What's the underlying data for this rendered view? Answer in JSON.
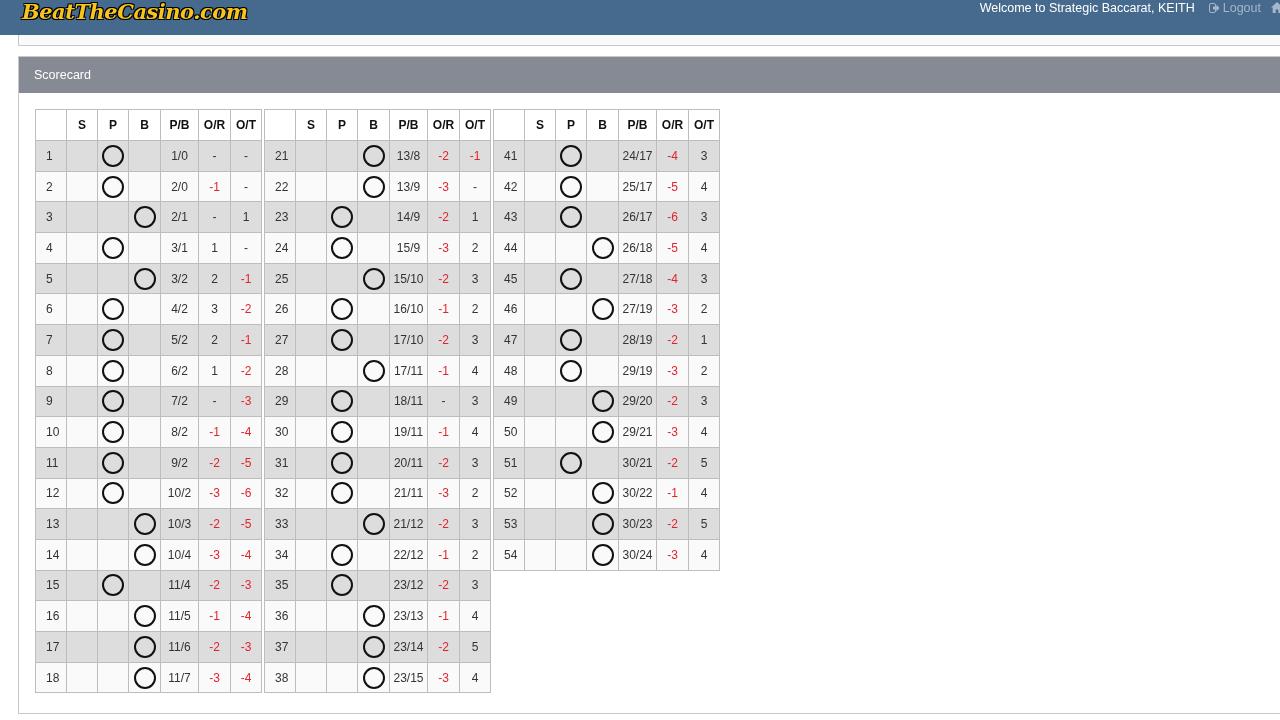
{
  "header": {
    "logo": "BeatTheCasino.com",
    "welcome": "Welcome to Strategic Baccarat, KEITH",
    "logout": "Logout"
  },
  "panel": {
    "title": "Scorecard"
  },
  "tables": [
    {
      "columns": [
        "",
        "S",
        "P",
        "B",
        "P/B",
        "O/R",
        "O/T"
      ],
      "rows": [
        {
          "number": "1",
          "player": true,
          "banker": false,
          "pb": "1/0",
          "or": "-",
          "ot": "-"
        },
        {
          "number": "2",
          "player": true,
          "banker": false,
          "pb": "2/0",
          "or": "-1",
          "ot": "-"
        },
        {
          "number": "3",
          "player": false,
          "banker": true,
          "pb": "2/1",
          "or": "-",
          "ot": "1"
        },
        {
          "number": "4",
          "player": true,
          "banker": false,
          "pb": "3/1",
          "or": "1",
          "ot": "-"
        },
        {
          "number": "5",
          "player": false,
          "banker": true,
          "pb": "3/2",
          "or": "2",
          "ot": "-1"
        },
        {
          "number": "6",
          "player": true,
          "banker": false,
          "pb": "4/2",
          "or": "3",
          "ot": "-2"
        },
        {
          "number": "7",
          "player": true,
          "banker": false,
          "pb": "5/2",
          "or": "2",
          "ot": "-1"
        },
        {
          "number": "8",
          "player": true,
          "banker": false,
          "pb": "6/2",
          "or": "1",
          "ot": "-2"
        },
        {
          "number": "9",
          "player": true,
          "banker": false,
          "pb": "7/2",
          "or": "-",
          "ot": "-3"
        },
        {
          "number": "10",
          "player": true,
          "banker": false,
          "pb": "8/2",
          "or": "-1",
          "ot": "-4"
        },
        {
          "number": "11",
          "player": true,
          "banker": false,
          "pb": "9/2",
          "or": "-2",
          "ot": "-5"
        },
        {
          "number": "12",
          "player": true,
          "banker": false,
          "pb": "10/2",
          "or": "-3",
          "ot": "-6"
        },
        {
          "number": "13",
          "player": false,
          "banker": true,
          "pb": "10/3",
          "or": "-2",
          "ot": "-5"
        },
        {
          "number": "14",
          "player": false,
          "banker": true,
          "pb": "10/4",
          "or": "-3",
          "ot": "-4"
        },
        {
          "number": "15",
          "player": true,
          "banker": false,
          "pb": "11/4",
          "or": "-2",
          "ot": "-3"
        },
        {
          "number": "16",
          "player": false,
          "banker": true,
          "pb": "11/5",
          "or": "-1",
          "ot": "-4"
        },
        {
          "number": "17",
          "player": false,
          "banker": true,
          "pb": "11/6",
          "or": "-2",
          "ot": "-3"
        },
        {
          "number": "18",
          "player": false,
          "banker": true,
          "pb": "11/7",
          "or": "-3",
          "ot": "-4"
        }
      ]
    },
    {
      "columns": [
        "",
        "S",
        "P",
        "B",
        "P/B",
        "O/R",
        "O/T"
      ],
      "rows": [
        {
          "number": "21",
          "player": false,
          "banker": true,
          "pb": "13/8",
          "or": "-2",
          "ot": "-1"
        },
        {
          "number": "22",
          "player": false,
          "banker": true,
          "pb": "13/9",
          "or": "-3",
          "ot": "-"
        },
        {
          "number": "23",
          "player": true,
          "banker": false,
          "pb": "14/9",
          "or": "-2",
          "ot": "1"
        },
        {
          "number": "24",
          "player": true,
          "banker": false,
          "pb": "15/9",
          "or": "-3",
          "ot": "2"
        },
        {
          "number": "25",
          "player": false,
          "banker": true,
          "pb": "15/10",
          "or": "-2",
          "ot": "3"
        },
        {
          "number": "26",
          "player": true,
          "banker": false,
          "pb": "16/10",
          "or": "-1",
          "ot": "2"
        },
        {
          "number": "27",
          "player": true,
          "banker": false,
          "pb": "17/10",
          "or": "-2",
          "ot": "3"
        },
        {
          "number": "28",
          "player": false,
          "banker": true,
          "pb": "17/11",
          "or": "-1",
          "ot": "4"
        },
        {
          "number": "29",
          "player": true,
          "banker": false,
          "pb": "18/11",
          "or": "-",
          "ot": "3"
        },
        {
          "number": "30",
          "player": true,
          "banker": false,
          "pb": "19/11",
          "or": "-1",
          "ot": "4"
        },
        {
          "number": "31",
          "player": true,
          "banker": false,
          "pb": "20/11",
          "or": "-2",
          "ot": "3"
        },
        {
          "number": "32",
          "player": true,
          "banker": false,
          "pb": "21/11",
          "or": "-3",
          "ot": "2"
        },
        {
          "number": "33",
          "player": false,
          "banker": true,
          "pb": "21/12",
          "or": "-2",
          "ot": "3"
        },
        {
          "number": "34",
          "player": true,
          "banker": false,
          "pb": "22/12",
          "or": "-1",
          "ot": "2"
        },
        {
          "number": "35",
          "player": true,
          "banker": false,
          "pb": "23/12",
          "or": "-2",
          "ot": "3"
        },
        {
          "number": "36",
          "player": false,
          "banker": true,
          "pb": "23/13",
          "or": "-1",
          "ot": "4"
        },
        {
          "number": "37",
          "player": false,
          "banker": true,
          "pb": "23/14",
          "or": "-2",
          "ot": "5"
        },
        {
          "number": "38",
          "player": false,
          "banker": true,
          "pb": "23/15",
          "or": "-3",
          "ot": "4"
        }
      ]
    },
    {
      "columns": [
        "",
        "S",
        "P",
        "B",
        "P/B",
        "O/R",
        "O/T"
      ],
      "rows": [
        {
          "number": "41",
          "player": true,
          "banker": false,
          "pb": "24/17",
          "or": "-4",
          "ot": "3"
        },
        {
          "number": "42",
          "player": true,
          "banker": false,
          "pb": "25/17",
          "or": "-5",
          "ot": "4"
        },
        {
          "number": "43",
          "player": true,
          "banker": false,
          "pb": "26/17",
          "or": "-6",
          "ot": "3"
        },
        {
          "number": "44",
          "player": false,
          "banker": true,
          "pb": "26/18",
          "or": "-5",
          "ot": "4"
        },
        {
          "number": "45",
          "player": true,
          "banker": false,
          "pb": "27/18",
          "or": "-4",
          "ot": "3"
        },
        {
          "number": "46",
          "player": false,
          "banker": true,
          "pb": "27/19",
          "or": "-3",
          "ot": "2"
        },
        {
          "number": "47",
          "player": true,
          "banker": false,
          "pb": "28/19",
          "or": "-2",
          "ot": "1"
        },
        {
          "number": "48",
          "player": true,
          "banker": false,
          "pb": "29/19",
          "or": "-3",
          "ot": "2"
        },
        {
          "number": "49",
          "player": false,
          "banker": true,
          "pb": "29/20",
          "or": "-2",
          "ot": "3"
        },
        {
          "number": "50",
          "player": false,
          "banker": true,
          "pb": "29/21",
          "or": "-3",
          "ot": "4"
        },
        {
          "number": "51",
          "player": true,
          "banker": false,
          "pb": "30/21",
          "or": "-2",
          "ot": "5"
        },
        {
          "number": "52",
          "player": false,
          "banker": true,
          "pb": "30/22",
          "or": "-1",
          "ot": "4"
        },
        {
          "number": "53",
          "player": false,
          "banker": true,
          "pb": "30/23",
          "or": "-2",
          "ot": "5"
        },
        {
          "number": "54",
          "player": false,
          "banker": true,
          "pb": "30/24",
          "or": "-3",
          "ot": "4"
        }
      ]
    }
  ]
}
